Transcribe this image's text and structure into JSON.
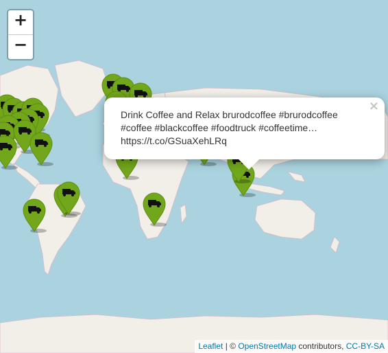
{
  "map": {
    "zoom_in_label": "+",
    "zoom_out_label": "−",
    "marker_icon": "food-truck-icon",
    "marker_color": "#72a71b",
    "ocean_color": "#aad3df",
    "land_color": "#f2efe9",
    "popup": {
      "text": "Drink Coffee and Relax brurodcoffee #brurodcoffee\n#coffee #blackcoffee #foodtruck #coffeetime…\nhttps://t.co/GSuaXehLRq",
      "close_label": "×"
    },
    "attribution": {
      "leaflet": "Leaflet",
      "sep1": " | © ",
      "osm": "OpenStreetMap",
      "contributors": " contributors, ",
      "license": "CC-BY-SA"
    }
  }
}
